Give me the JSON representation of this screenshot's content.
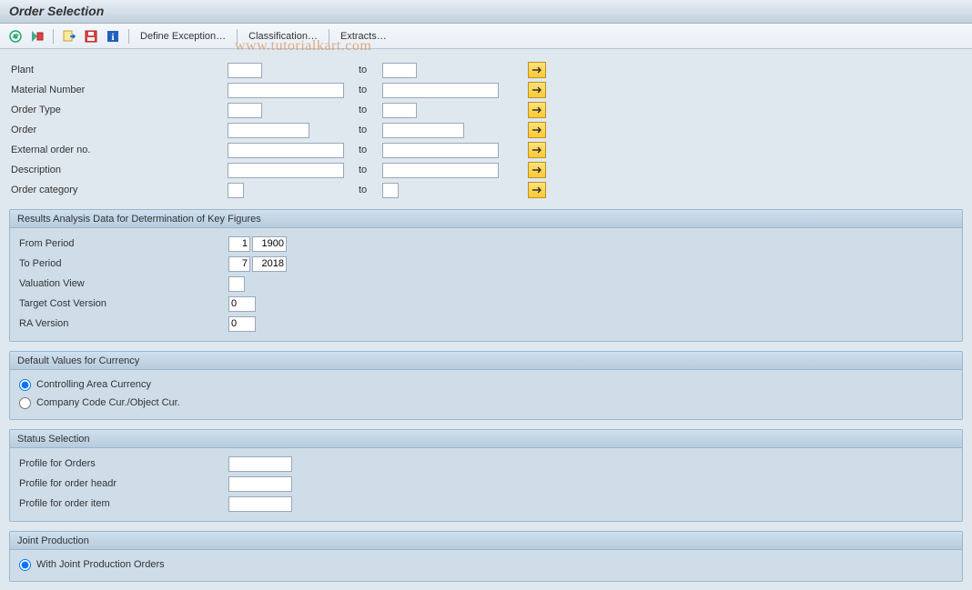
{
  "title": "Order Selection",
  "toolbar": {
    "define_exception": "Define Exception…",
    "classification": "Classification…",
    "extracts": "Extracts…"
  },
  "watermark": "www.tutorialkart.com",
  "selection": {
    "rows": [
      {
        "label": "Plant",
        "size": "short",
        "from": "",
        "to": ""
      },
      {
        "label": "Material Number",
        "size": "long",
        "from": "",
        "to": ""
      },
      {
        "label": "Order Type",
        "size": "short",
        "from": "",
        "to": ""
      },
      {
        "label": "Order",
        "size": "med",
        "from": "",
        "to": ""
      },
      {
        "label": "External order no.",
        "size": "long",
        "from": "",
        "to": ""
      },
      {
        "label": "Description",
        "size": "long",
        "from": "",
        "to": ""
      },
      {
        "label": "Order category",
        "size": "tiny",
        "from": "",
        "to": ""
      }
    ],
    "to_label": "to"
  },
  "results_group": {
    "header": "Results Analysis Data for Determination of Key Figures",
    "from_period_label": "From Period",
    "from_period_m": "1",
    "from_period_y": "1900",
    "to_period_label": "To Period",
    "to_period_m": "7",
    "to_period_y": "2018",
    "valuation_view_label": "Valuation View",
    "valuation_view": "",
    "target_cost_label": "Target Cost Version",
    "target_cost": "0",
    "ra_version_label": "RA Version",
    "ra_version": "0"
  },
  "currency_group": {
    "header": "Default Values for Currency",
    "opt1": "Controlling Area Currency",
    "opt2": "Company Code Cur./Object Cur."
  },
  "status_group": {
    "header": "Status Selection",
    "profile_orders_label": "Profile for Orders",
    "profile_orders": "",
    "profile_headr_label": "Profile for order headr",
    "profile_headr": "",
    "profile_item_label": "Profile for order item",
    "profile_item": ""
  },
  "joint_group": {
    "header": "Joint Production",
    "opt1": "With Joint Production Orders"
  }
}
